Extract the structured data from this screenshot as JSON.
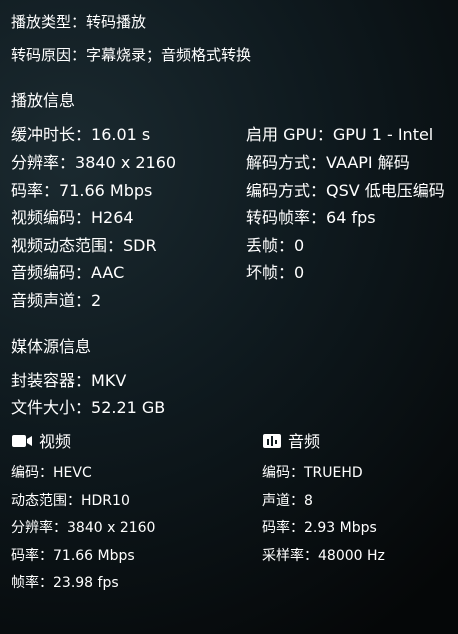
{
  "top": {
    "play_type_label": "播放类型：",
    "play_type_value": "转码播放",
    "transcode_reason_label": "转码原因：",
    "transcode_reason_value": "字幕烧录；音频格式转换"
  },
  "playback_info": {
    "title": "播放信息",
    "left": [
      {
        "label": "缓冲时长：",
        "value": "16.01 s"
      },
      {
        "label": "分辨率：",
        "value": "3840 x 2160"
      },
      {
        "label": "码率：",
        "value": "71.66 Mbps"
      },
      {
        "label": "视频编码：",
        "value": "H264"
      },
      {
        "label": "视频动态范围：",
        "value": "SDR"
      },
      {
        "label": "音频编码：",
        "value": "AAC"
      },
      {
        "label": "音频声道：",
        "value": "2"
      }
    ],
    "right": [
      {
        "label": "启用 GPU：",
        "value": "GPU 1 - Intel"
      },
      {
        "label": "解码方式：",
        "value": "VAAPI 解码"
      },
      {
        "label": "编码方式：",
        "value": "QSV 低电压编码"
      },
      {
        "label": "转码帧率：",
        "value": "64 fps"
      },
      {
        "label": "丢帧：",
        "value": "0"
      },
      {
        "label": "坏帧：",
        "value": "0"
      }
    ]
  },
  "media_source": {
    "title": "媒体源信息",
    "container_label": "封装容器：",
    "container_value": "MKV",
    "file_size_label": "文件大小：",
    "file_size_value": "52.21 GB",
    "video": {
      "title": "视频",
      "icon": "video-camera-icon",
      "rows": [
        {
          "label": "编码：",
          "value": "HEVC"
        },
        {
          "label": "动态范围：",
          "value": "HDR10"
        },
        {
          "label": "分辨率：",
          "value": "3840 x 2160"
        },
        {
          "label": "码率：",
          "value": "71.66 Mbps"
        },
        {
          "label": "帧率：",
          "value": "23.98 fps"
        }
      ]
    },
    "audio": {
      "title": "音频",
      "icon": "audio-waveform-icon",
      "rows": [
        {
          "label": "编码：",
          "value": "TRUEHD"
        },
        {
          "label": "声道：",
          "value": "8"
        },
        {
          "label": "码率：",
          "value": "2.93 Mbps"
        },
        {
          "label": "采样率：",
          "value": "48000 Hz"
        }
      ]
    }
  }
}
